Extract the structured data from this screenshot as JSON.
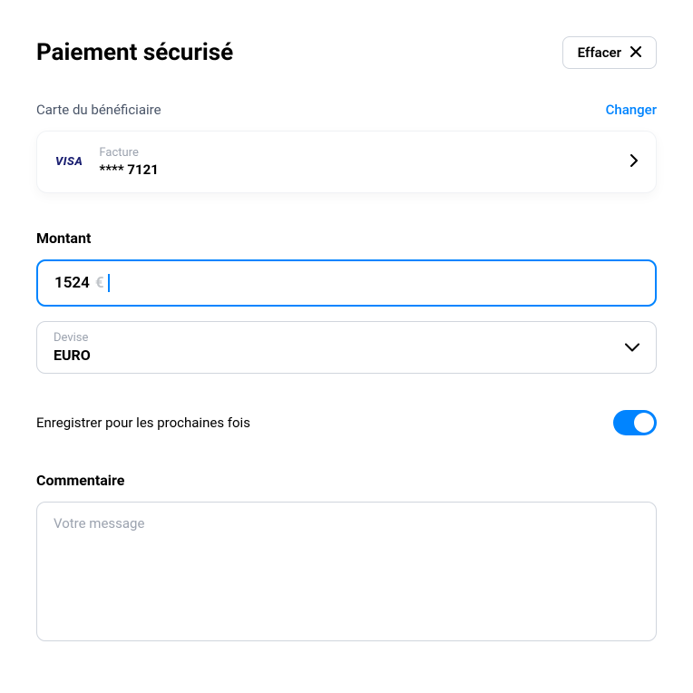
{
  "header": {
    "title": "Paiement sécurisé",
    "clear_label": "Effacer"
  },
  "card": {
    "section_label": "Carte du bénéficiaire",
    "change_label": "Changer",
    "brand": "VISA",
    "sublabel": "Facture",
    "masked_number": "**** 7121"
  },
  "amount": {
    "label": "Montant",
    "value": "1524",
    "currency_symbol": "€"
  },
  "currency": {
    "label": "Devise",
    "value": "EURO"
  },
  "save_toggle": {
    "label": "Enregistrer pour les prochaines fois",
    "enabled": true
  },
  "comment": {
    "label": "Commentaire",
    "placeholder": "Votre message"
  },
  "colors": {
    "accent": "#0084ff",
    "border": "#d0d5dd",
    "muted": "#9ca3af"
  }
}
